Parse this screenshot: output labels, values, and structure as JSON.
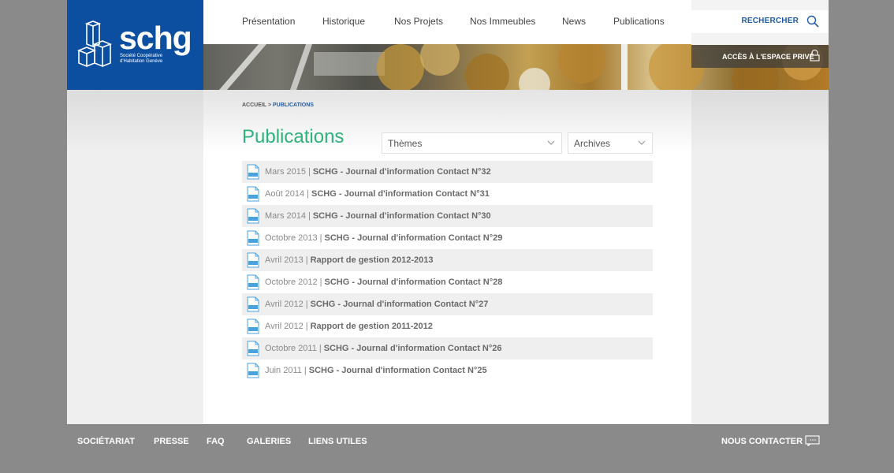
{
  "brand": {
    "name": "schg",
    "tagline": "Société Coopérative d'Habitation Genève"
  },
  "nav": {
    "items": [
      "Présentation",
      "Historique",
      "Nos Projets",
      "Nos Immeubles",
      "News",
      "Publications"
    ]
  },
  "search": {
    "label": "RECHERCHER",
    "icon": "search-icon"
  },
  "private_access": {
    "label": "ACCÈS À L'ESPACE PRIVÉ",
    "icon": "lock-icon"
  },
  "breadcrumb": {
    "home": "ACCUEIL",
    "separator": ">",
    "current": "PUBLICATIONS"
  },
  "page": {
    "title": "Publications"
  },
  "filters": {
    "themes": {
      "value": "Thèmes"
    },
    "archives": {
      "value": "Archives"
    }
  },
  "publications": [
    {
      "date": "Mars 2015",
      "title": "SCHG - Journal d'information Contact N°32"
    },
    {
      "date": "Août 2014",
      "title": "SCHG - Journal d'information Contact N°31"
    },
    {
      "date": "Mars 2014",
      "title": "SCHG - Journal d'information Contact N°30"
    },
    {
      "date": "Octobre 2013",
      "title": "SCHG - Journal d'information Contact N°29"
    },
    {
      "date": "Avril 2013",
      "title": "Rapport de gestion 2012-2013"
    },
    {
      "date": "Octobre 2012",
      "title": "SCHG - Journal d'information Contact N°28"
    },
    {
      "date": "Avril 2012",
      "title": "SCHG - Journal d'information Contact N°27"
    },
    {
      "date": "Avril 2012",
      "title": "Rapport de gestion 2011-2012"
    },
    {
      "date": "Octobre 2011",
      "title": "SCHG - Journal d'information Contact N°26"
    },
    {
      "date": "Juin 2011",
      "title": "SCHG - Journal d'information Contact N°25"
    }
  ],
  "footer": {
    "links": [
      "SOCIÉTARIAT",
      "PRESSE",
      "FAQ",
      "GALERIES",
      "LIENS UTILES"
    ],
    "contact": "NOUS CONTACTER"
  },
  "colors": {
    "brand_blue": "#0c4fa0",
    "title_green": "#2db27a",
    "link_blue": "#1f5aa6",
    "pdf_blue": "#4aa3df"
  }
}
